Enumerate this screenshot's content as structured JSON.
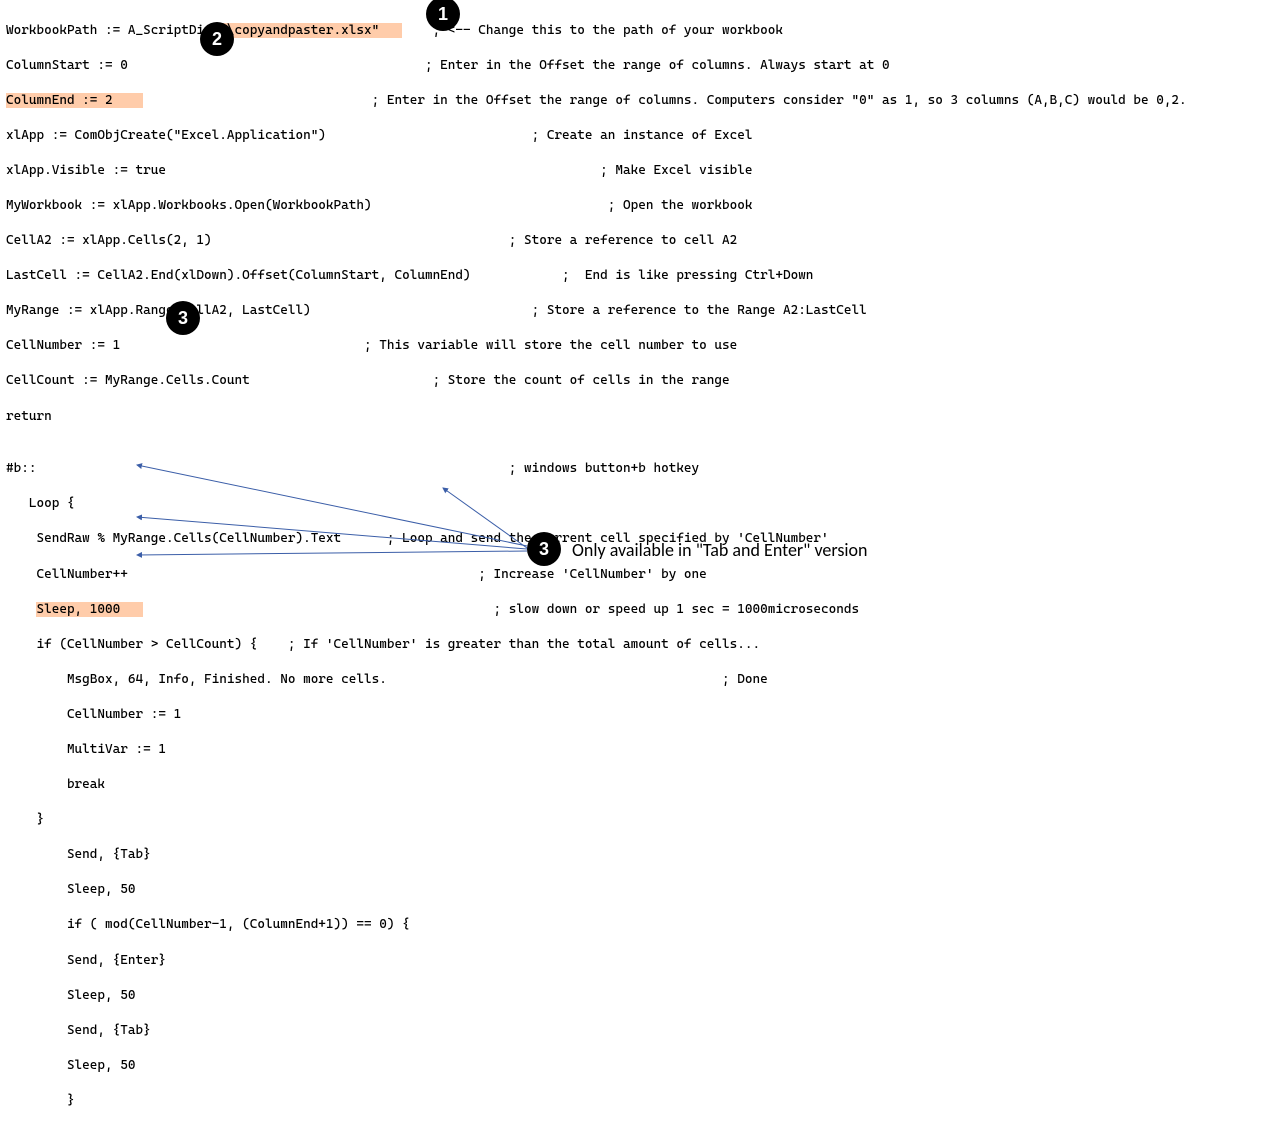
{
  "code": {
    "l1a": "WorkbookPath := A_ScriptDir ",
    "l1hl": "\"\\copyandpaster.xlsx\"   ",
    "l1b": "    ; <-- Change this to the path of your workbook",
    "l2": "ColumnStart := 0                                       ; Enter in the Offset the range of columns. Always start at 0",
    "l3hl": "ColumnEnd := 2    ",
    "l3b": "                              ; Enter in the Offset the range of columns. Computers consider \"0\" as 1, so 3 columns (A,B,C) would be 0,2.",
    "l4": "xlApp := ComObjCreate(\"Excel.Application\")                           ; Create an instance of Excel",
    "l5": "xlApp.Visible := true                                                         ; Make Excel visible",
    "l6": "MyWorkbook := xlApp.Workbooks.Open(WorkbookPath)                               ; Open the workbook",
    "l7": "CellA2 := xlApp.Cells(2, 1)                                       ; Store a reference to cell A2",
    "l8": "LastCell := CellA2.End(xlDown).Offset(ColumnStart, ColumnEnd)            ;  End is like pressing Ctrl+Down",
    "l9": "MyRange := xlApp.Range(CellA2, LastCell)                             ; Store a reference to the Range A2:LastCell",
    "l10": "CellNumber := 1                                ; This variable will store the cell number to use",
    "l11": "CellCount := MyRange.Cells.Count                        ; Store the count of cells in the range",
    "l12": "return",
    "l13": "",
    "l14": "#b::                                                              ; windows button+b hotkey",
    "l15": "   Loop {",
    "l16": "    SendRaw % MyRange.Cells(CellNumber).Text      ; Loop and send the current cell specified by 'CellNumber'",
    "l17": "    CellNumber++                                              ; Increase 'CellNumber' by one",
    "l18a": "    ",
    "l18hl": "Sleep, 1000   ",
    "l18b": "                                              ; slow down or speed up 1 sec = 1000microseconds",
    "l19": "    if (CellNumber > CellCount) {    ; If 'CellNumber' is greater than the total amount of cells...",
    "l20": "        MsgBox, 64, Info, Finished. No more cells.                                            ; Done",
    "l21": "        CellNumber := 1",
    "l22": "        MultiVar := 1",
    "l23": "        break",
    "l24": "    }",
    "l25": "        Send, {Tab}",
    "l26": "        Sleep, 50",
    "l27": "        if ( mod(CellNumber-1, (ColumnEnd+1)) == 0) {",
    "l28": "        Send, {Enter}",
    "l29": "        Sleep, 50",
    "l30": "        Send, {Tab}",
    "l31": "        Sleep, 50",
    "l32": "        }"
  },
  "badges": {
    "b1": "1",
    "b2": "2",
    "b3": "3",
    "b3b": "3"
  },
  "annot": {
    "tab_enter_note": "Only available in \"Tab and Enter\" version"
  }
}
